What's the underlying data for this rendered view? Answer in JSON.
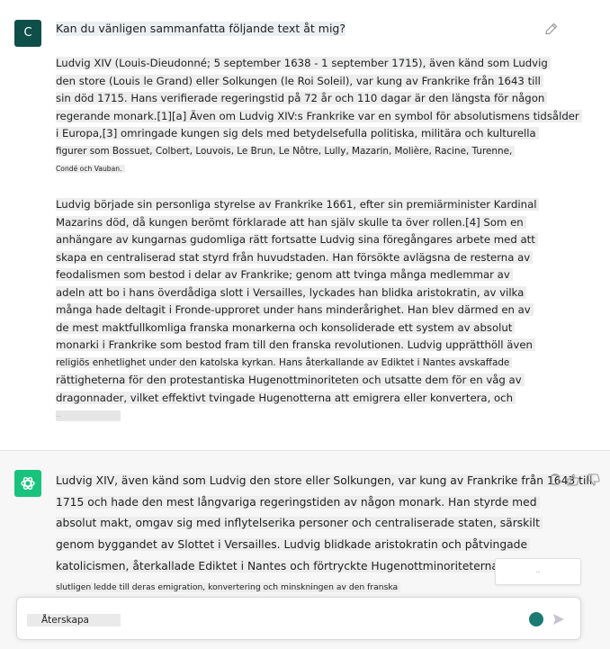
{
  "user": {
    "avatar_letter": "C",
    "prompt_title": "Kan du vänligen sammanfatta följande text åt mig?",
    "paragraph1": [
      "Ludvig XIV (Louis-Dieudonné; 5 september 1638 - 1 september 1715), även känd som Ludvig",
      " den store (Louis le Grand) eller Solkungen (le Roi Soleil), var kung av Frankrike från 1643 till",
      "sin död 1715. Hans verifierade regeringstid på 72 år och 110 dagar är den längsta för någon",
      "regerande monark.[1][a] Även om Ludvig XIV:s Frankrike var en symbol för absolutismens tidsålder",
      "i Europa,[3] omringade kungen sig dels med betydelsefulla politiska, militära och kulturella",
      "figurer som Bossuet, Colbert, Louvois, Le Brun, Le Nôtre, Lully, Mazarin, Molière, Racine, Turenne,",
      "Condé och Vauban."
    ],
    "paragraph2": [
      "Ludvig började sin personliga styrelse av Frankrike 1661, efter sin premiärminister Kardinal",
      "Mazarins död, då kungen berömt förklarade att han själv skulle ta över rollen.[4] Som en",
      "anhängare av kungarnas gudomliga rätt fortsatte Ludvig sina föregångares arbete med att",
      "skapa en centraliserad stat styrd från huvudstaden. Han försökte avlägsna de resterna av",
      "feodalismen som bestod i delar av Frankrike; genom att tvinga många medlemmar av",
      "adeln att bo i hans överdådiga slott i Versailles, lyckades han blidka aristokratin, av vilka",
      "många hade deltagit i Fronde-upproret under hans minderårighet. Han blev därmed en av",
      "de mest maktfullkomliga franska monarkerna och konsoliderade ett system av absolut",
      "monarki i Frankrike som bestod fram till den franska revolutionen. Ludvig upprätthöll även",
      "religiös enhetlighet under den katolska kyrkan. Hans återkallande av Ediktet i Nantes avskaffade",
      "rättigheterna för den protestantiska Hugenottminoriteten och utsatte dem för en våg av",
      "dragonnader, vilket effektivt tvingade Hugenotterna att emigrera eller konvertera, och"
    ],
    "paragraph2_cut": "…"
  },
  "assistant": {
    "answer_lines": [
      "Ludvig XIV, även känd som Ludvig den store eller Solkungen, var kung av Frankrike från 1643 till",
      "1715 och hade den mest långvariga regeringstiden av någon monark. Han styrde med",
      "absolut makt, omgav sig med inflytelserika personer och centraliserade staten, särskilt",
      "genom byggandet av Slottet i Versailles. Ludvig blidkade aristokratin och påtvingade",
      "katolicismen, återkallade Ediktet i Nantes och förtryckte Hugenottminoriteterna, vilket",
      "slutligen ledde till deras emigration, konvertering och minskningen av den franska"
    ],
    "tooltip": "…"
  },
  "composer": {
    "regenerate_label": "Återskapa"
  }
}
